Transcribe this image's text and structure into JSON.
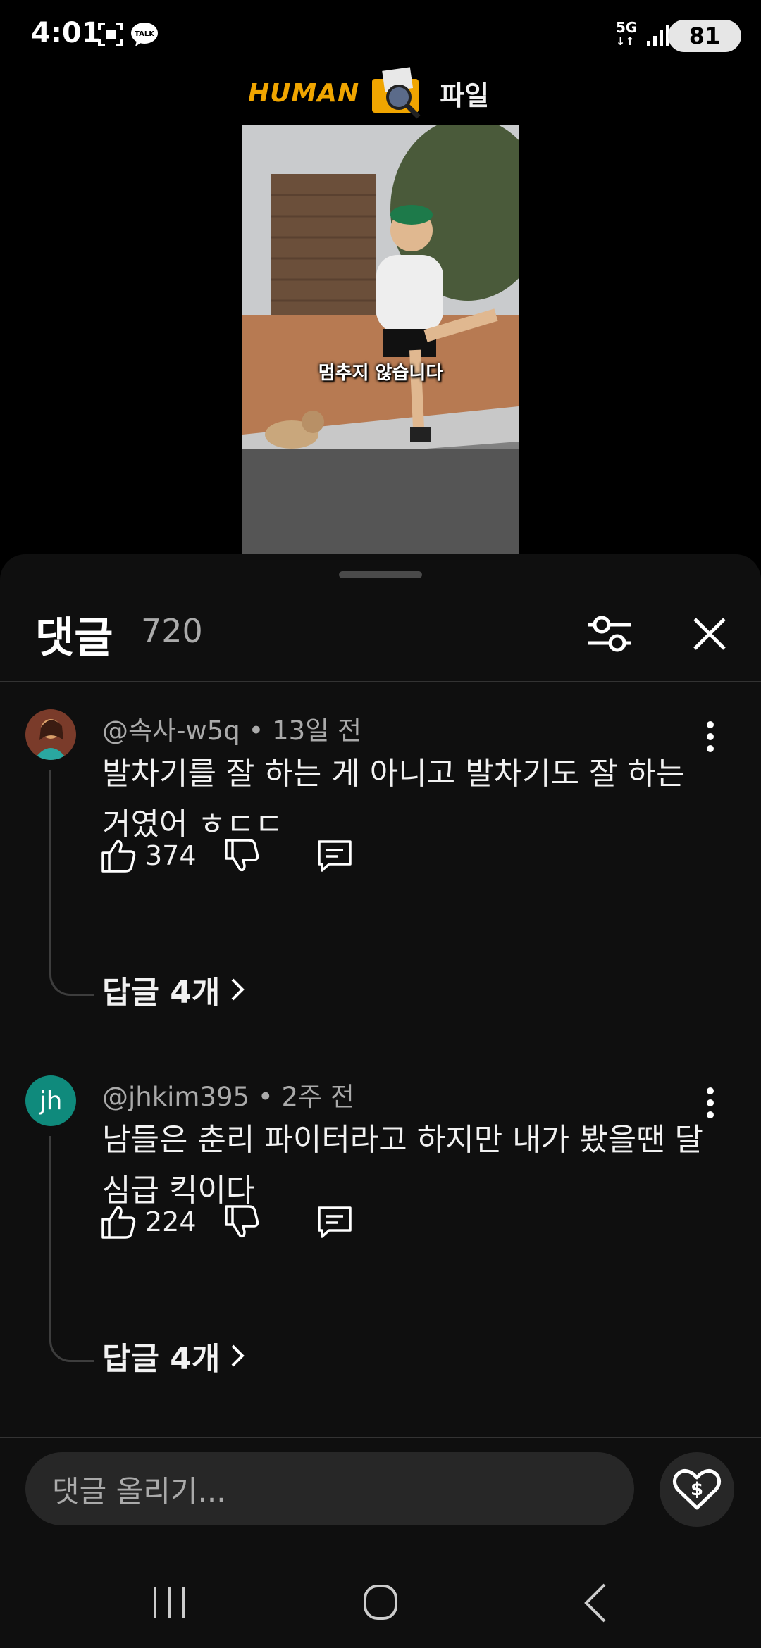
{
  "status_bar": {
    "time": "4:01",
    "network": "5G",
    "battery": "81",
    "icons": [
      "screenshot-icon",
      "kakaotalk-icon",
      "signal-icon"
    ]
  },
  "video": {
    "logo_left": "HUMAN",
    "logo_right": "파일",
    "caption": "멈추지 않습니다"
  },
  "comments_panel": {
    "title": "댓글",
    "count": "720",
    "comments": [
      {
        "author": "@속사-w5q",
        "time": "13일 전",
        "text": "발차기를 잘 하는 게 아니고 발차기도 잘 하는 거였어 ㅎㄷㄷ",
        "likes": "374",
        "replies_label": "답글 4개"
      },
      {
        "author": "@jhkim395",
        "time": "2주 전",
        "avatar_initials": "jh",
        "text": "남들은 춘리 파이터라고 하지만 내가 봤을땐 달심급 킥이다",
        "likes": "224",
        "replies_label": "답글 4개"
      }
    ],
    "input_placeholder": "댓글 올리기..."
  },
  "colors": {
    "background": "#000000",
    "sheet": "#0f0f0f",
    "avatar_jh": "#0f8a7c",
    "muted_text": "#aaaaaa"
  }
}
